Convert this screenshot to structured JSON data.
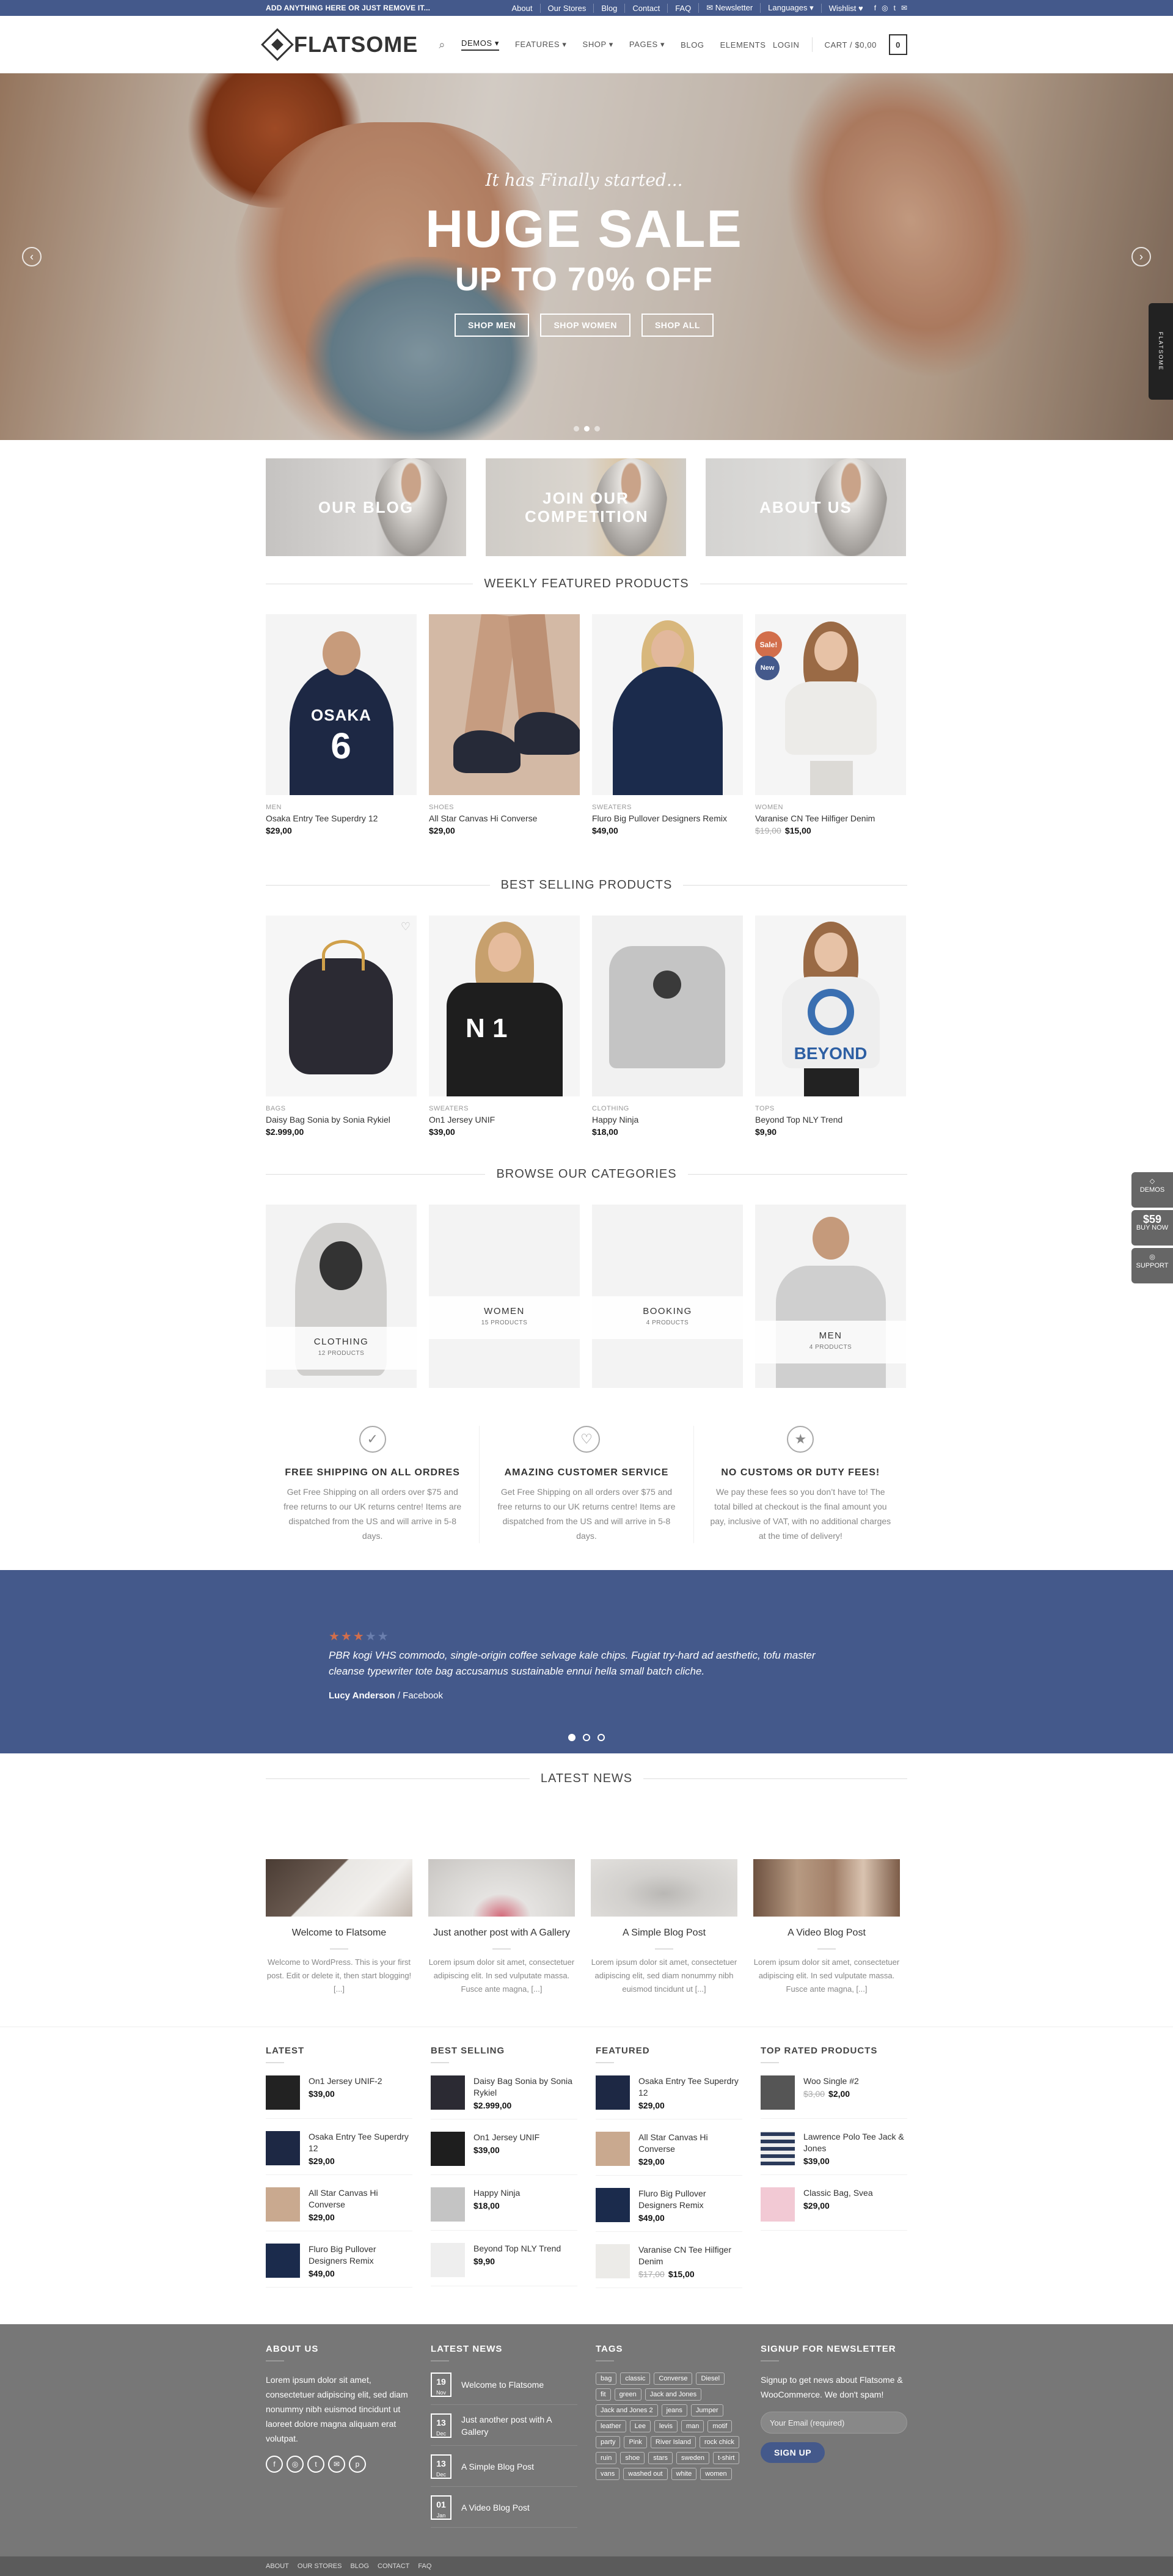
{
  "topbar": {
    "message": "ADD ANYTHING HERE OR JUST REMOVE IT...",
    "links": [
      "About",
      "Our Stores",
      "Blog",
      "Contact",
      "FAQ",
      "Newsletter",
      "Languages",
      "Wishlist"
    ]
  },
  "header": {
    "logo": "FLATSOME",
    "nav": [
      "DEMOS",
      "FEATURES",
      "SHOP",
      "PAGES",
      "BLOG",
      "ELEMENTS"
    ],
    "login": "LOGIN",
    "cart": "CART / $0,00",
    "cart_count": "0"
  },
  "hero": {
    "script": "It has Finally started...",
    "title": "HUGE SALE",
    "subtitle": "UP TO 70% OFF",
    "buttons": [
      "SHOP MEN",
      "SHOP WOMEN",
      "SHOP ALL"
    ],
    "side_tab": "FLATSOME"
  },
  "promos": [
    "OUR BLOG",
    "JOIN OUR COMPETITION",
    "ABOUT US"
  ],
  "sections": {
    "featured": "WEEKLY FEATURED PRODUCTS",
    "best": "BEST SELLING PRODUCTS",
    "categories": "BROWSE OUR CATEGORIES",
    "news": "LATEST NEWS"
  },
  "featured_products": [
    {
      "cat": "MEN",
      "name": "Osaka Entry Tee Superdry 12",
      "price": "$29,00",
      "old": ""
    },
    {
      "cat": "SHOES",
      "name": "All Star Canvas Hi Converse",
      "price": "$29,00",
      "old": ""
    },
    {
      "cat": "SWEATERS",
      "name": "Fluro Big Pullover Designers Remix",
      "price": "$49,00",
      "old": ""
    },
    {
      "cat": "WOMEN",
      "name": "Varanise CN Tee Hilfiger Denim",
      "price": "$15,00",
      "old": "$19,00"
    }
  ],
  "badges": {
    "sale": "Sale!",
    "new": "New"
  },
  "best_products": [
    {
      "cat": "BAGS",
      "name": "Daisy Bag Sonia by Sonia Rykiel",
      "price": "$2.999,00"
    },
    {
      "cat": "SWEATERS",
      "name": "On1 Jersey UNIF",
      "price": "$39,00"
    },
    {
      "cat": "CLOTHING",
      "name": "Happy Ninja",
      "price": "$18,00"
    },
    {
      "cat": "TOPS",
      "name": "Beyond Top NLY Trend",
      "price": "$9,90"
    }
  ],
  "categories": [
    {
      "name": "CLOTHING",
      "count": "12 PRODUCTS"
    },
    {
      "name": "WOMEN",
      "count": "15 PRODUCTS"
    },
    {
      "name": "BOOKING",
      "count": "4 PRODUCTS"
    },
    {
      "name": "MEN",
      "count": "4 PRODUCTS"
    }
  ],
  "features": [
    {
      "title": "FREE SHIPPING ON ALL ORDRES",
      "text": "Get Free Shipping on all orders over $75 and free returns to our UK returns centre! Items are dispatched from the US and will arrive in 5-8 days."
    },
    {
      "title": "AMAZING CUSTOMER SERVICE",
      "text": "Get Free Shipping on all orders over $75 and free returns to our UK returns centre! Items are dispatched from the US and will arrive in 5-8 days."
    },
    {
      "title": "NO CUSTOMS OR DUTY FEES!",
      "text": "We pay these fees so you don’t have to! The total billed at checkout is the final amount you pay, inclusive of VAT, with no additional charges at the time of delivery!"
    }
  ],
  "testimonial": {
    "rating": 3,
    "quote": "PBR kogi VHS commodo, single-origin coffee selvage kale chips. Fugiat try-hard ad aesthetic, tofu master cleanse typewriter tote bag accusamus sustainable ennui hella small batch cliche.",
    "name": "Lucy Anderson",
    "source": " / Facebook"
  },
  "news": [
    {
      "title": "Welcome to Flatsome",
      "excerpt": "Welcome to WordPress. This is your first post. Edit or delete it, then start blogging! [...]"
    },
    {
      "title": "Just another post with A Gallery",
      "excerpt": "Lorem ipsum dolor sit amet, consectetuer adipiscing elit. In sed vulputate massa. Fusce ante magna, [...]"
    },
    {
      "title": "A Simple Blog Post",
      "excerpt": "Lorem ipsum dolor sit amet, consectetuer adipiscing elit, sed diam nonummy nibh euismod tincidunt ut [...]"
    },
    {
      "title": "A Video Blog Post",
      "excerpt": "Lorem ipsum dolor sit amet, consectetuer adipiscing elit. In sed vulputate massa. Fusce ante magna, [...]"
    }
  ],
  "widgets": {
    "latest": {
      "title": "LATEST",
      "items": [
        {
          "name": "On1 Jersey UNIF-2",
          "price": "$39,00"
        },
        {
          "name": "Osaka Entry Tee Superdry 12",
          "price": "$29,00"
        },
        {
          "name": "All Star Canvas Hi Converse",
          "price": "$29,00"
        },
        {
          "name": "Fluro Big Pullover Designers Remix",
          "price": "$49,00"
        }
      ]
    },
    "best": {
      "title": "BEST SELLING",
      "items": [
        {
          "name": "Daisy Bag Sonia by Sonia Rykiel",
          "price": "$2.999,00"
        },
        {
          "name": "On1 Jersey UNIF",
          "price": "$39,00"
        },
        {
          "name": "Happy Ninja",
          "price": "$18,00"
        },
        {
          "name": "Beyond Top NLY Trend",
          "price": "$9,90"
        }
      ]
    },
    "featured": {
      "title": "FEATURED",
      "items": [
        {
          "name": "Osaka Entry Tee Superdry 12",
          "price": "$29,00",
          "old": ""
        },
        {
          "name": "All Star Canvas Hi Converse",
          "price": "$29,00",
          "old": ""
        },
        {
          "name": "Fluro Big Pullover Designers Remix",
          "price": "$49,00",
          "old": ""
        },
        {
          "name": "Varanise CN Tee Hilfiger Denim",
          "price": "$15,00",
          "old": "$17,00"
        }
      ]
    },
    "top": {
      "title": "TOP RATED PRODUCTS",
      "items": [
        {
          "name": "Woo Single #2",
          "price": "$2,00",
          "old": "$3,00"
        },
        {
          "name": "Lawrence Polo Tee Jack & Jones",
          "price": "$39,00",
          "old": ""
        },
        {
          "name": "Classic Bag, Svea",
          "price": "$29,00",
          "old": ""
        }
      ]
    }
  },
  "footer": {
    "about_title": "ABOUT US",
    "about_text": "Lorem ipsum dolor sit amet, consectetuer adipiscing elit, sed diam nonummy nibh euismod tincidunt ut laoreet dolore magna aliquam erat volutpat.",
    "news_title": "LATEST NEWS",
    "news": [
      {
        "day": "19",
        "mon": "Nov",
        "title": "Welcome to Flatsome"
      },
      {
        "day": "13",
        "mon": "Dec",
        "title": "Just another post with A Gallery"
      },
      {
        "day": "13",
        "mon": "Dec",
        "title": "A Simple Blog Post"
      },
      {
        "day": "01",
        "mon": "Jan",
        "title": "A Video Blog Post"
      }
    ],
    "tags_title": "TAGS",
    "tags": [
      "bag",
      "classic",
      "Converse",
      "Diesel",
      "fit",
      "green",
      "Jack and Jones",
      "Jack and Jones 2",
      "jeans",
      "Jumper",
      "leather",
      "Lee",
      "levis",
      "man",
      "motif",
      "party",
      "Pink",
      "River Island",
      "rock chick",
      "ruin",
      "shoe",
      "stars",
      "sweden",
      "t-shirt",
      "vans",
      "washed out",
      "white",
      "women"
    ],
    "signup_title": "SIGNUP FOR NEWSLETTER",
    "signup_text": "Signup to get news about Flatsome & WooCommerce. We don't spam!",
    "email_placeholder": "Your Email (required)",
    "signup_button": "SIGN UP",
    "bottom_links": [
      "ABOUT",
      "OUR STORES",
      "BLOG",
      "CONTACT",
      "FAQ"
    ]
  },
  "side_widgets": [
    {
      "top": "",
      "label": "DEMOS"
    },
    {
      "top": "$59",
      "label": "BUY NOW"
    },
    {
      "top": "",
      "label": "SUPPORT"
    }
  ],
  "colors": {
    "brand": "#44598b",
    "sale": "#d26e4b",
    "footer": "#777777"
  }
}
